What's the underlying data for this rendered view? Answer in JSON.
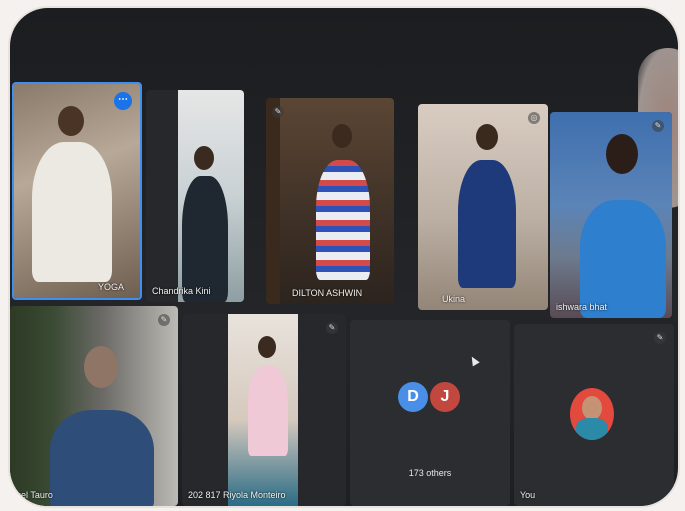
{
  "participants": [
    {
      "id": "yoga",
      "name": "YOGA"
    },
    {
      "id": "chandrika",
      "name": "Chandrika Kini"
    },
    {
      "id": "dilton",
      "name": "DILTON ASHWIN"
    },
    {
      "id": "ukina",
      "name": "Ukina"
    },
    {
      "id": "ishwara",
      "name": "ishwara bhat"
    },
    {
      "id": "tauro",
      "name": "uel Tauro"
    },
    {
      "id": "riyola",
      "name": "202 817 Riyola Monteiro"
    },
    {
      "id": "you",
      "name": "You"
    }
  ],
  "others_tile": {
    "avatar_1": "D",
    "avatar_2": "J",
    "avatar_1_color": "#4a8fe7",
    "avatar_2_color": "#c2473f",
    "count_label": "173 others"
  },
  "icons": {
    "pin": "pin-icon",
    "more": "more-options-icon"
  },
  "colors": {
    "active_speaker_border": "#3f8ff0",
    "meeting_background": "#1e2023"
  }
}
